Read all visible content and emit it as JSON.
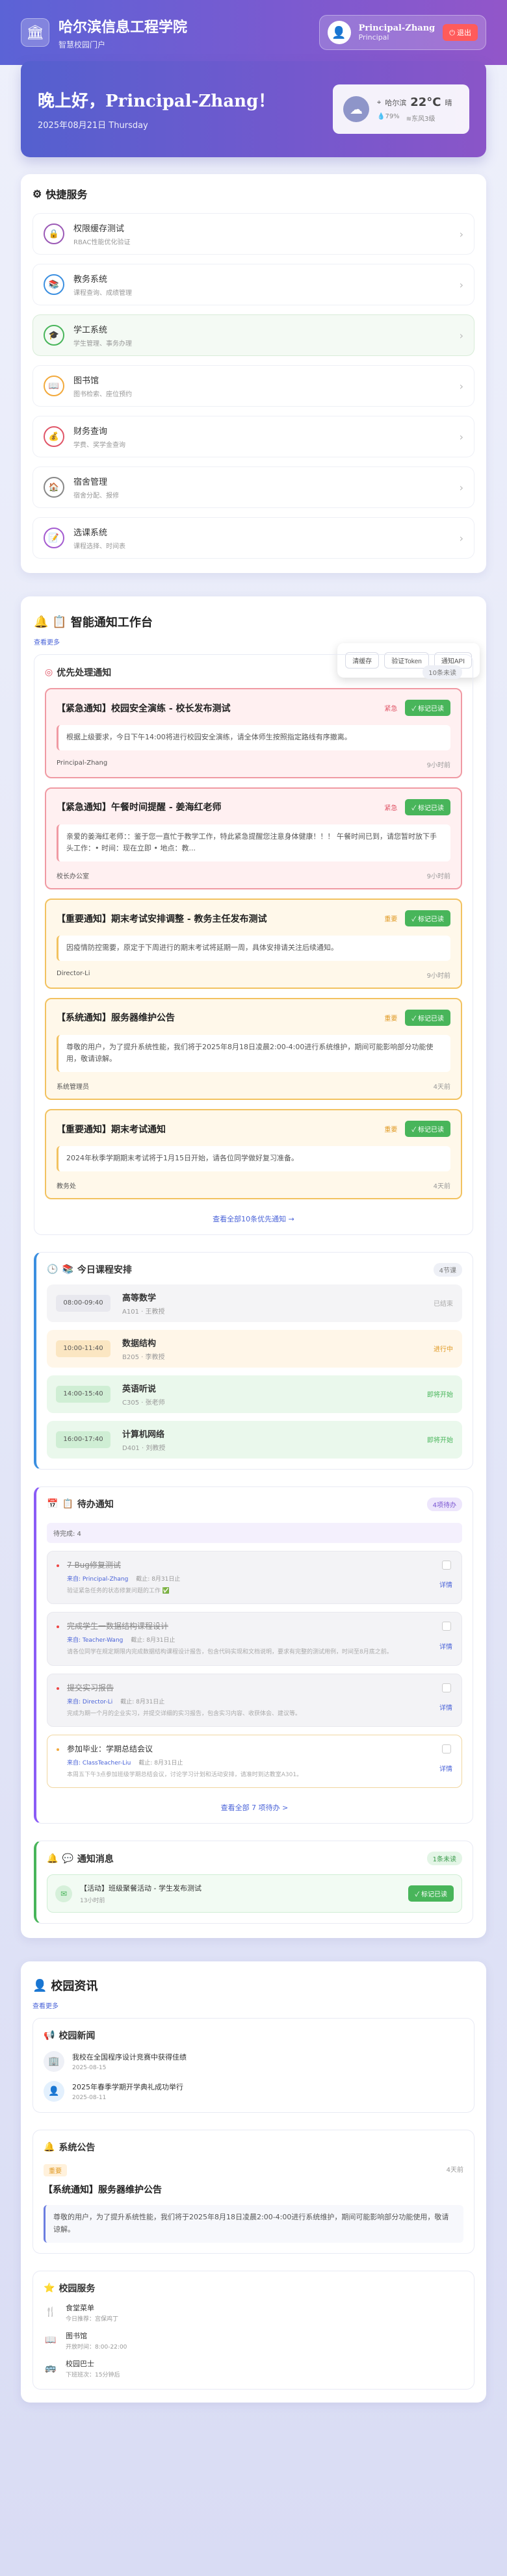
{
  "header": {
    "school_name": "哈尔滨信息工程学院",
    "portal_name": "智慧校园门户",
    "user_name": "Principal-Zhang",
    "user_role": "Principal",
    "logout_label": "退出"
  },
  "welcome": {
    "greeting": "晚上好，Principal-Zhang！",
    "date": "2025年08月21日 Thursday",
    "weather_city": "哈尔滨",
    "weather_temp": "22°C",
    "weather_desc": "晴",
    "humidity": "79%",
    "wind": "东风3级"
  },
  "quick": {
    "title": "快捷服务",
    "items": [
      {
        "title": "权限缓存测试",
        "desc": "RBAC性能优化验证",
        "color": "#9b59b6"
      },
      {
        "title": "教务系统",
        "desc": "课程查询、成绩管理",
        "color": "#3b8fe0"
      },
      {
        "title": "学工系统",
        "desc": "学生管理、事务办理",
        "color": "#48b55a"
      },
      {
        "title": "图书馆",
        "desc": "图书检索、座位预约",
        "color": "#f2a93b"
      },
      {
        "title": "财务查询",
        "desc": "学费、奖学金查询",
        "color": "#e05567"
      },
      {
        "title": "宿舍管理",
        "desc": "宿舍分配、报修",
        "color": "#888888"
      },
      {
        "title": "选课系统",
        "desc": "课程选择、时间表",
        "color": "#a35bd0"
      }
    ],
    "popover": [
      "清缓存",
      "验证Token",
      "通知API"
    ]
  },
  "workbench": {
    "title": "智能通知工作台",
    "more": "查看更多",
    "priority": {
      "title": "优先处理通知",
      "count": "10条未读",
      "read_label": "标记已读",
      "view_all": "查看全部10条优先通知 →",
      "items": [
        {
          "type": "urgent",
          "title": "【紧急通知】校园安全演练 - 校长发布测试",
          "tag": "紧急",
          "body": "根据上级要求，今日下午14:00将进行校园安全演练，请全体师生按照指定路线有序撤离。",
          "author": "Principal-Zhang",
          "time": "9小时前"
        },
        {
          "type": "urgent",
          "title": "【紧急通知】午餐时间提醒 - 姜海红老师",
          "tag": "紧急",
          "body": "亲爱的姜海红老师：：鉴于您一直忙于教学工作，特此紧急提醒您注意身体健康！！！ 午餐时间已到，请您暂时放下手头工作：• 时间：现在立即 • 地点：教...",
          "author": "校长办公室",
          "time": "9小时前"
        },
        {
          "type": "important",
          "title": "【重要通知】期末考试安排调整 - 教务主任发布测试",
          "tag": "重要",
          "body": "因疫情防控需要，原定于下周进行的期末考试将延期一周，具体安排请关注后续通知。",
          "author": "Director-Li",
          "time": "9小时前"
        },
        {
          "type": "important",
          "title": "【系统通知】服务器维护公告",
          "tag": "重要",
          "body": "尊敬的用户，为了提升系统性能，我们将于2025年8月18日凌晨2:00-4:00进行系统维护，期间可能影响部分功能使用，敬请谅解。",
          "author": "系统管理员",
          "time": "4天前"
        },
        {
          "type": "important",
          "title": "【重要通知】期末考试通知",
          "tag": "重要",
          "body": "2024年秋季学期期末考试将于1月15日开始，请各位同学做好复习准备。",
          "author": "教务处",
          "time": "4天前"
        }
      ]
    },
    "courses": {
      "title": "今日课程安排",
      "count": "4节课",
      "items": [
        {
          "time": "08:00-09:40",
          "name": "高等数学",
          "room": "A101 · 王教授",
          "status": "已结束",
          "bg": "#f4f4f6",
          "tbg": "#e8e8ee",
          "scolor": "#aaaaaa"
        },
        {
          "time": "10:00-11:40",
          "name": "数据结构",
          "room": "B205 · 李教授",
          "status": "进行中",
          "bg": "#fff6e8",
          "tbg": "#fbe6c2",
          "scolor": "#e09a25"
        },
        {
          "time": "14:00-15:40",
          "name": "英语听说",
          "room": "C305 · 张老师",
          "status": "即将开始",
          "bg": "#eaf8ec",
          "tbg": "#cfeed4",
          "scolor": "#48b55a"
        },
        {
          "time": "16:00-17:40",
          "name": "计算机网络",
          "room": "D401 · 刘教授",
          "status": "即将开始",
          "bg": "#eaf8ec",
          "tbg": "#cfeed4",
          "scolor": "#48b55a"
        }
      ]
    },
    "todos": {
      "title": "待办通知",
      "count": "4项待办",
      "progress": "待完成: 4",
      "detail": "详情",
      "view_all": "查看全部 7 项待办 >",
      "items": [
        {
          "state": "done",
          "title": "7 Bug修复测试",
          "source": "来自: Principal-Zhang",
          "deadline": "截止: 8月31日止",
          "desc": "验证紧急任务的状态修复问题的工作 ✅"
        },
        {
          "state": "done",
          "title": "完成学生一数据结构课程设计",
          "source": "来自: Teacher-Wang",
          "deadline": "截止: 8月31日止",
          "desc": "请各位同学在规定期限内完成数据结构课程设计报告，包含代码实现和文档说明，要求有完整的测试用例，时间至8月底之前。"
        },
        {
          "state": "done",
          "title": "提交实习报告",
          "source": "来自: Director-Li",
          "deadline": "截止: 8月31日止",
          "desc": "完成为期一个月的企业实习，并提交详细的实习报告，包含实习内容、收获体会、建议等。"
        },
        {
          "state": "open",
          "title": "参加毕业：学期总结会议",
          "source": "来自: ClassTeacher-Liu",
          "deadline": "截止: 8月31日止",
          "desc": "本周五下午3点参加班级学期总结会议，讨论学习计划和活动安排，请准时到达教室A301。"
        }
      ]
    },
    "messages": {
      "title": "通知消息",
      "count": "1条未读",
      "read_label": "标记已读",
      "items": [
        {
          "title": "【活动】班级聚餐活动 - 学生发布测试",
          "time": "13小时前"
        }
      ]
    }
  },
  "campus": {
    "title": "校园资讯",
    "more": "查看更多",
    "news_title": "校园新闻",
    "news": [
      {
        "title": "我校在全国程序设计竞赛中获得佳绩",
        "date": "2025-08-15"
      },
      {
        "title": "2025年春季学期开学典礼成功举行",
        "date": "2025-08-11"
      }
    ],
    "announce_title": "系统公告",
    "announce_tag": "重要",
    "announce_time": "4天前",
    "announce_heading": "【系统通知】服务器维护公告",
    "announce_body": "尊敬的用户，为了提升系统性能，我们将于2025年8月18日凌晨2:00-4:00进行系统维护，期间可能影响部分功能使用，敬请谅解。",
    "services_title": "校园服务",
    "services": [
      {
        "name": "食堂菜单",
        "desc": "今日推荐：宫保鸡丁",
        "icon": "🍴"
      },
      {
        "name": "图书馆",
        "desc": "开放时间：8:00-22:00",
        "icon": "📖"
      },
      {
        "name": "校园巴士",
        "desc": "下班班次：15分钟后",
        "icon": "🚌"
      }
    ]
  }
}
